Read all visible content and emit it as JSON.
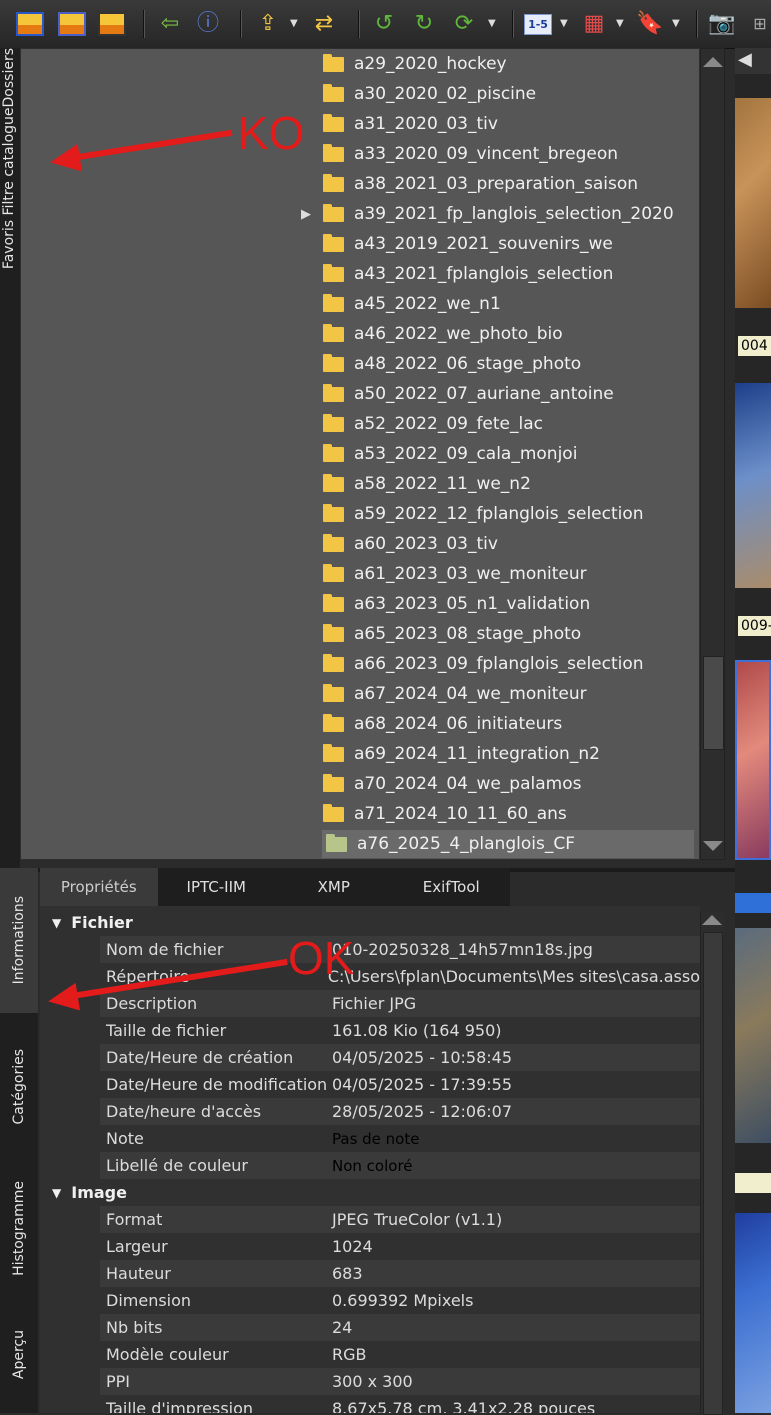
{
  "toolbar": {
    "icons": [
      "view-icon",
      "fullscreen-icon",
      "slideshow-icon",
      "import-icon",
      "info-icon",
      "export-icon",
      "convert-icon",
      "rotate-left-icon",
      "rotate-right-icon",
      "refresh-icon",
      "rating-icon",
      "color-label-icon",
      "bookmark-icon",
      "camera-icon"
    ],
    "rating_label": "1-5"
  },
  "left_tab": {
    "label": "Favoris Filtre catalogueDossiers"
  },
  "tree": {
    "items": [
      {
        "name": "a29_2020_hockey"
      },
      {
        "name": "a30_2020_02_piscine"
      },
      {
        "name": "a31_2020_03_tiv"
      },
      {
        "name": "a33_2020_09_vincent_bregeon"
      },
      {
        "name": "a38_2021_03_preparation_saison"
      },
      {
        "name": "a39_2021_fp_langlois_selection_2020"
      },
      {
        "name": "a43_2019_2021_souvenirs_we"
      },
      {
        "name": "a43_2021_fplanglois_selection"
      },
      {
        "name": "a45_2022_we_n1"
      },
      {
        "name": "a46_2022_we_photo_bio"
      },
      {
        "name": "a48_2022_06_stage_photo"
      },
      {
        "name": "a50_2022_07_auriane_antoine"
      },
      {
        "name": "a52_2022_09_fete_lac"
      },
      {
        "name": "a53_2022_09_cala_monjoi"
      },
      {
        "name": "a58_2022_11_we_n2"
      },
      {
        "name": "a59_2022_12_fplanglois_selection"
      },
      {
        "name": "a60_2023_03_tiv"
      },
      {
        "name": "a61_2023_03_we_moniteur"
      },
      {
        "name": "a63_2023_05_n1_validation"
      },
      {
        "name": "a65_2023_08_stage_photo"
      },
      {
        "name": "a66_2023_09_fplanglois_selection"
      },
      {
        "name": "a67_2024_04_we_moniteur"
      },
      {
        "name": "a68_2024_06_initiateurs"
      },
      {
        "name": "a69_2024_11_integration_n2"
      },
      {
        "name": "a70_2024_04_we_palamos"
      },
      {
        "name": "a71_2024_10_11_60_ans"
      },
      {
        "name": "a76_2025_4_planglois_CF"
      }
    ]
  },
  "bottom_tabs": [
    "Informations",
    "Catégories",
    "Histogramme",
    "Aperçu"
  ],
  "prop_tabs": [
    "Propriétés",
    "IPTC-IIM",
    "XMP",
    "ExifTool"
  ],
  "fichier": {
    "title": "Fichier",
    "rows": [
      {
        "label": "Nom de fichier",
        "value": "010-20250328_14h57mn18s.jpg"
      },
      {
        "label": "Répertoire",
        "value": "C:\\Users\\fplan\\Documents\\Mes sites\\casa.asso"
      },
      {
        "label": "Description",
        "value": "Fichier JPG"
      },
      {
        "label": "Taille de fichier",
        "value": "161.08 Kio (164 950)"
      },
      {
        "label": "Date/Heure de création",
        "value": "04/05/2025 - 10:58:45"
      },
      {
        "label": "Date/Heure de modification",
        "value": "04/05/2025 - 17:39:55"
      },
      {
        "label": "Date/heure d'accès",
        "value": "28/05/2025 - 12:06:07"
      },
      {
        "label": "Note",
        "value": "Pas de note"
      },
      {
        "label": "Libellé de couleur",
        "value": "Non coloré"
      }
    ]
  },
  "image": {
    "title": "Image",
    "rows": [
      {
        "label": "Format",
        "value": "JPEG TrueColor (v1.1)"
      },
      {
        "label": "Largeur",
        "value": "1024"
      },
      {
        "label": "Hauteur",
        "value": "683"
      },
      {
        "label": "Dimension",
        "value": "0.699392 Mpixels"
      },
      {
        "label": "Nb bits",
        "value": "24"
      },
      {
        "label": "Modèle couleur",
        "value": "RGB"
      },
      {
        "label": "PPI",
        "value": "300 x 300"
      },
      {
        "label": "Taille d'impression",
        "value": "8.67x5.78 cm, 3.41x2.28 pouces"
      }
    ]
  },
  "thumbnails": [
    {
      "label": "004"
    },
    {
      "label": "009-"
    }
  ],
  "annotations": {
    "ko": "KO",
    "ok": "OK",
    "color": "#e31b1b"
  }
}
